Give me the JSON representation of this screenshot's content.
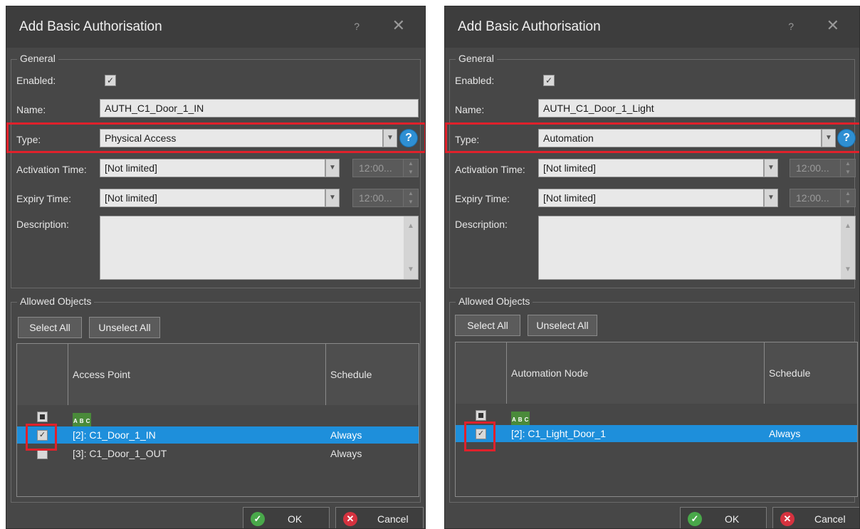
{
  "dialogs": [
    {
      "title": "Add Basic Authorisation",
      "help_glyph": "?",
      "close_glyph": "✕",
      "general_label": "General",
      "enabled_label": "Enabled:",
      "enabled_checked": true,
      "name_label": "Name:",
      "name_value": "AUTH_C1_Door_1_IN",
      "type_label": "Type:",
      "type_value": "Physical Access",
      "activation_label": "Activation Time:",
      "activation_value": "[Not limited]",
      "activation_time": "12:00...",
      "expiry_label": "Expiry Time:",
      "expiry_value": "[Not limited]",
      "expiry_time": "12:00...",
      "description_label": "Description:",
      "description_value": "",
      "allowed_label": "Allowed Objects",
      "select_all": "Select All",
      "unselect_all": "Unselect All",
      "col_name": "Access Point",
      "col_schedule": "Schedule",
      "filter_icon_text": [
        "A",
        "B",
        "C"
      ],
      "rows": [
        {
          "name": "[2]: C1_Door_1_IN",
          "schedule": "Always",
          "checked": true,
          "selected": true
        },
        {
          "name": "[3]: C1_Door_1_OUT",
          "schedule": "Always",
          "checked": false,
          "selected": false
        }
      ],
      "ok": "OK",
      "cancel": "Cancel"
    },
    {
      "title": "Add Basic Authorisation",
      "help_glyph": "?",
      "close_glyph": "✕",
      "general_label": "General",
      "enabled_label": "Enabled:",
      "enabled_checked": true,
      "name_label": "Name:",
      "name_value": "AUTH_C1_Door_1_Light",
      "type_label": "Type:",
      "type_value": "Automation",
      "activation_label": "Activation Time:",
      "activation_value": "[Not limited]",
      "activation_time": "12:00...",
      "expiry_label": "Expiry Time:",
      "expiry_value": "[Not limited]",
      "expiry_time": "12:00...",
      "description_label": "Description:",
      "description_value": "",
      "allowed_label": "Allowed Objects",
      "select_all": "Select All",
      "unselect_all": "Unselect All",
      "col_name": "Automation Node",
      "col_schedule": "Schedule",
      "filter_icon_text": [
        "A",
        "B",
        "C"
      ],
      "rows": [
        {
          "name": "[2]: C1_Light_Door_1",
          "schedule": "Always",
          "checked": true,
          "selected": true
        }
      ],
      "ok": "OK",
      "cancel": "Cancel"
    }
  ],
  "colors": {
    "dialog_bg": "#474747",
    "selection": "#1e8fdb",
    "highlight_box": "#e0212b",
    "ok_icon": "#49a84a",
    "cancel_icon": "#d6323f"
  },
  "icons": {
    "help": "help-icon",
    "close": "close-icon",
    "ok": "checkmark-icon",
    "cancel": "cross-icon",
    "type_help": "question-icon"
  }
}
